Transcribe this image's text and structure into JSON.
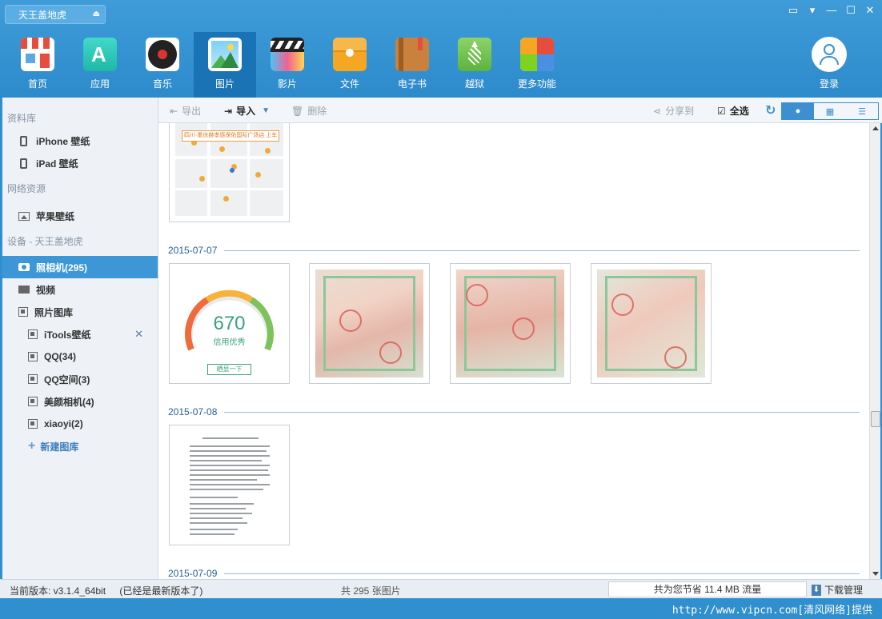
{
  "window": {
    "device_tab": "天王盖地虎",
    "device_tab_icon": "apple-icon",
    "eject_icon": "eject-icon",
    "controls": [
      "feedback-icon",
      "menu-icon",
      "minimize-icon",
      "maximize-icon",
      "close-icon"
    ]
  },
  "nav": {
    "items": [
      {
        "label": "首页",
        "icon": "home-store-icon"
      },
      {
        "label": "应用",
        "icon": "app-store-icon"
      },
      {
        "label": "音乐",
        "icon": "music-disc-icon"
      },
      {
        "label": "图片",
        "icon": "photo-icon",
        "active": true
      },
      {
        "label": "影片",
        "icon": "clapperboard-icon"
      },
      {
        "label": "文件",
        "icon": "folder-icon"
      },
      {
        "label": "电子书",
        "icon": "ebook-icon"
      },
      {
        "label": "越狱",
        "icon": "pineapple-icon"
      },
      {
        "label": "更多功能",
        "icon": "more-tiles-icon"
      }
    ],
    "login_label": "登录"
  },
  "sidebar": {
    "library_title": "资料库",
    "iphone_wallpaper": "iPhone 壁纸",
    "ipad_wallpaper": "iPad 壁纸",
    "network_title": "网络资源",
    "apple_wallpaper": "苹果壁纸",
    "device_title": "设备 - 天王盖地虎",
    "camera": "照相机(295)",
    "video": "视频",
    "album_lib": "照片图库",
    "albums": [
      {
        "label": "iTools壁纸",
        "closable": true
      },
      {
        "label": "QQ(34)"
      },
      {
        "label": "QQ空间(3)"
      },
      {
        "label": "美颜相机(4)"
      },
      {
        "label": "xiaoyi(2)"
      }
    ],
    "new_album": "新建图库"
  },
  "toolbar": {
    "export": "导出",
    "import": "导入",
    "delete": "删除",
    "share": "分享到",
    "select_all": "全选"
  },
  "content": {
    "dates": [
      "2015-07-07",
      "2015-07-08",
      "2015-07-09"
    ],
    "map_banner": "四川·重庆赫孝感保佑国际广场店 上车",
    "credit_score": "670",
    "credit_text": "信用优秀",
    "credit_button": "晒显一下"
  },
  "status": {
    "version": "当前版本: v3.1.4_64bit",
    "latest": "(已经是最新版本了)",
    "total": "共 295 张图片",
    "saved": "共为您节省  11.4 MB 流量",
    "download": "下载管理"
  },
  "footer": {
    "watermark": "http://www.vipcn.com[清风网络]提供"
  }
}
